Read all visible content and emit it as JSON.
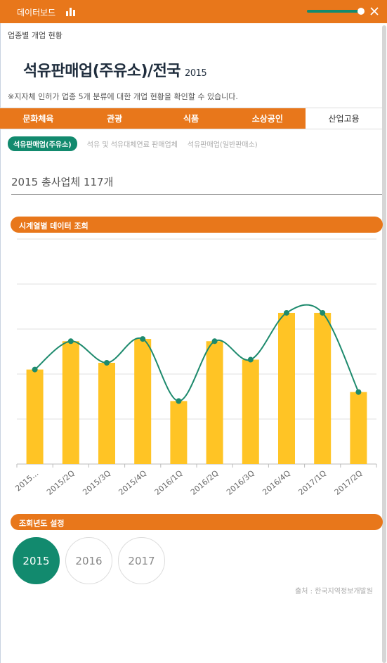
{
  "header": {
    "title": "데이터보드",
    "bar_icon": "bar-chart-icon",
    "toggle_icon": "slider-toggle-icon",
    "close_icon": "close-icon",
    "accent_color": "#e8771b"
  },
  "section_label": "업종별 개업 현황",
  "page_title": "석유판매업(주유소)/전국",
  "page_year": "2015",
  "notice": "※지자체 인허가 업종 5개 분류에 대한 개업 현황을 확인할 수 있습니다.",
  "tabs": [
    {
      "label": "문화체육",
      "active": false
    },
    {
      "label": "관광",
      "active": false
    },
    {
      "label": "식품",
      "active": false
    },
    {
      "label": "소상공인",
      "active": false
    },
    {
      "label": "산업고용",
      "active": true
    }
  ],
  "subtabs": [
    {
      "label": "석유판매업(주유소)",
      "active": true
    },
    {
      "label": "석유 및 석유대체연료 판매업체",
      "active": false
    },
    {
      "label": "석유판매업(일반판매소)",
      "active": false
    }
  ],
  "total_text": "2015 총사업체 117개",
  "timeseries_label": "시계열별 데이터 조회",
  "year_label": "조회년도 설정",
  "years": [
    {
      "label": "2015",
      "active": true
    },
    {
      "label": "2016",
      "active": false
    },
    {
      "label": "2017",
      "active": false
    }
  ],
  "source": "출처 : 한국지역정보개발원",
  "chart_data": {
    "type": "bar",
    "categories": [
      "2015…",
      "2015/2Q",
      "2015/3Q",
      "2015/4Q",
      "2016/1Q",
      "2016/2Q",
      "2016/3Q",
      "2016/4Q",
      "2017/1Q",
      "2017/2Q"
    ],
    "series": [
      {
        "type": "bar",
        "color": "#ffc425",
        "values": [
          21,
          27.3,
          22.5,
          27.8,
          14,
          27.3,
          23.2,
          33.6,
          33.6,
          16
        ]
      },
      {
        "type": "line",
        "color": "#1d8a6d",
        "values": [
          21,
          27.3,
          22.5,
          27.8,
          14,
          27.3,
          23.2,
          33.6,
          33.6,
          16
        ]
      }
    ],
    "ylim": [
      0,
      50
    ],
    "grid": true
  }
}
